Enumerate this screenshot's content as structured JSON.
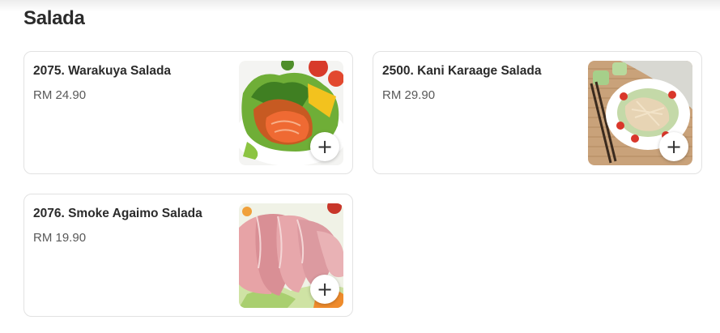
{
  "section": {
    "title": "Salada"
  },
  "items": [
    {
      "name": "2075. Warakuya Salada",
      "price": "RM 24.90",
      "image_icon": "salmon-salad-photo",
      "add_icon": "+"
    },
    {
      "name": "2500. Kani Karaage Salada",
      "price": "RM 29.90",
      "image_icon": "crab-salad-photo",
      "add_icon": "+"
    },
    {
      "name": "2076. Smoke Agaimo Salada",
      "price": "RM 19.90",
      "image_icon": "smoked-duck-salad-photo",
      "add_icon": "+"
    }
  ]
}
